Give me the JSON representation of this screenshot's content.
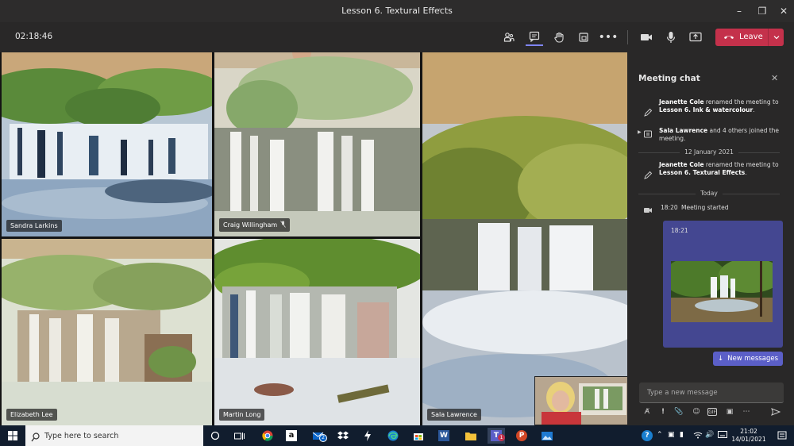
{
  "window": {
    "title": "Lesson 6. Textural Effects",
    "title_dots": "···"
  },
  "toolbar": {
    "timer": "02:18:46",
    "leave_label": "Leave",
    "colors": {
      "leave": "#c4314b",
      "accent": "#5b5fc7"
    }
  },
  "participants": [
    {
      "name": "Sandra Larkins"
    },
    {
      "name": "Craig Willingham",
      "muted": true
    },
    {
      "name": "Sala Lawrence"
    },
    {
      "name": "Elizabeth Lee"
    },
    {
      "name": "Martin Long"
    }
  ],
  "chat": {
    "header": "Meeting chat",
    "events": [
      {
        "actor": "Jeanette Cole",
        "text": " renamed the meeting to ",
        "target": "Lesson 6. Ink & watercolour",
        "suffix": "."
      },
      {
        "actor": "Sala Lawrence",
        "text": " and 4 others joined the meeting."
      },
      {
        "actor": "Jeanette Cole",
        "text": " renamed the meeting to ",
        "target": "Lesson 6. Textural Effects",
        "suffix": "."
      }
    ],
    "date_separator_1": "12 January 2021",
    "date_separator_2": "Today",
    "meeting_started_time": "18:20",
    "meeting_started_text": "Meeting started",
    "message_time": "18:21",
    "new_messages_label": "New messages",
    "compose_placeholder": "Type a new message"
  },
  "taskbar": {
    "search_placeholder": "Type here to search",
    "mail_badge": "2",
    "teams_badge": "1",
    "clock_time": "21:02",
    "clock_date": "14/01/2021"
  }
}
